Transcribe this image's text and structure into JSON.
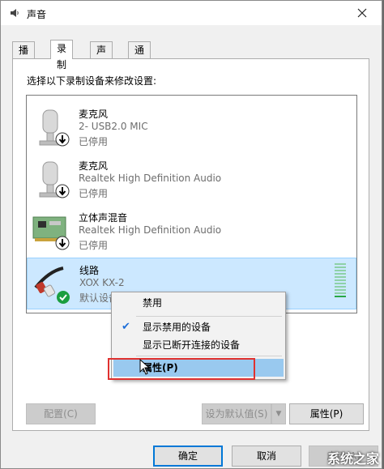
{
  "window": {
    "title": "声音",
    "app_icon": "speaker-icon",
    "close_icon": "close-icon"
  },
  "tabs": [
    {
      "label": "播放",
      "active": false
    },
    {
      "label": "录制",
      "active": true
    },
    {
      "label": "声音",
      "active": false
    },
    {
      "label": "通信",
      "active": false
    }
  ],
  "panel": {
    "instructions": "选择以下录制设备来修改设置:"
  },
  "devices": [
    {
      "name": "麦克风",
      "description": "2- USB2.0 MIC",
      "status": "已停用",
      "icon": "microphone-icon",
      "badge": "disabled-arrow-icon",
      "selected": false
    },
    {
      "name": "麦克风",
      "description": "Realtek High Definition Audio",
      "status": "已停用",
      "icon": "microphone-icon",
      "badge": "disabled-arrow-icon",
      "selected": false
    },
    {
      "name": "立体声混音",
      "description": "Realtek High Definition Audio",
      "status": "已停用",
      "icon": "sound-card-icon",
      "badge": "disabled-arrow-icon",
      "selected": false
    },
    {
      "name": "线路",
      "description": "XOX KX-2",
      "status": "默认设备",
      "icon": "line-in-cable-icon",
      "badge": "default-check-icon",
      "selected": true,
      "level": 0.1
    }
  ],
  "context_menu": {
    "items": [
      {
        "label": "禁用",
        "checked": false
      },
      {
        "label": "显示禁用的设备",
        "checked": true
      },
      {
        "label": "显示已断开连接的设备",
        "checked": false
      },
      {
        "label": "属性(P)",
        "checked": false,
        "hover": true
      }
    ]
  },
  "buttons": {
    "configure": "配置(C)",
    "set_default": "设为默认值(S)",
    "properties": "属性(P)",
    "ok": "确定",
    "cancel": "取消",
    "apply": "应用(A)"
  },
  "colors": {
    "selection": "#cce8ff",
    "menu_hover": "#99c9ef",
    "highlight_box": "#e0312f",
    "default_check": "#1a9e3f"
  },
  "watermark": "系统之家"
}
